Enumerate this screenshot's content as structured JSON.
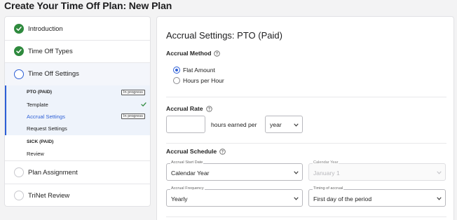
{
  "page": {
    "title": "Create Your Time Off Plan: New Plan"
  },
  "sidebar": {
    "steps": [
      {
        "label": "Introduction",
        "status": "done"
      },
      {
        "label": "Time Off Types",
        "status": "done"
      },
      {
        "label": "Time Off Settings",
        "status": "active"
      },
      {
        "label": "Plan Assignment",
        "status": "pending"
      },
      {
        "label": "TriNet Review",
        "status": "pending"
      }
    ],
    "sub_items": {
      "pto_label": "PTO (PAID)",
      "pto_badge": "In progress",
      "template": "Template",
      "accrual_settings": "Accrual Settings",
      "accrual_badge": "In progress",
      "request_settings": "Request Settings",
      "sick_label": "SICK (PAID)",
      "review": "Review"
    }
  },
  "main": {
    "title": "Accrual Settings: PTO (Paid)",
    "accrual_method": {
      "title": "Accrual Method",
      "options": [
        "Flat Amount",
        "Hours per Hour"
      ],
      "selected": "Flat Amount"
    },
    "accrual_rate": {
      "title": "Accrual Rate",
      "input_value": "",
      "suffix": "hours earned per",
      "period_value": "year"
    },
    "accrual_schedule": {
      "title": "Accrual Schedule",
      "start_date_label": "Accrual Start Date",
      "start_date_value": "Calendar Year",
      "calendar_year_label": "Calendar Year",
      "calendar_year_value": "January 1",
      "frequency_label": "Accrual Frequency",
      "frequency_value": "Yearly",
      "timing_label": "Timing of accrual",
      "timing_value": "First day of the period"
    }
  },
  "colors": {
    "accent": "#2d5fd6",
    "done": "#2f8a3e",
    "background": "#f3f3f4"
  },
  "icons": [
    "check-icon",
    "info-icon",
    "chevron-down-icon"
  ]
}
